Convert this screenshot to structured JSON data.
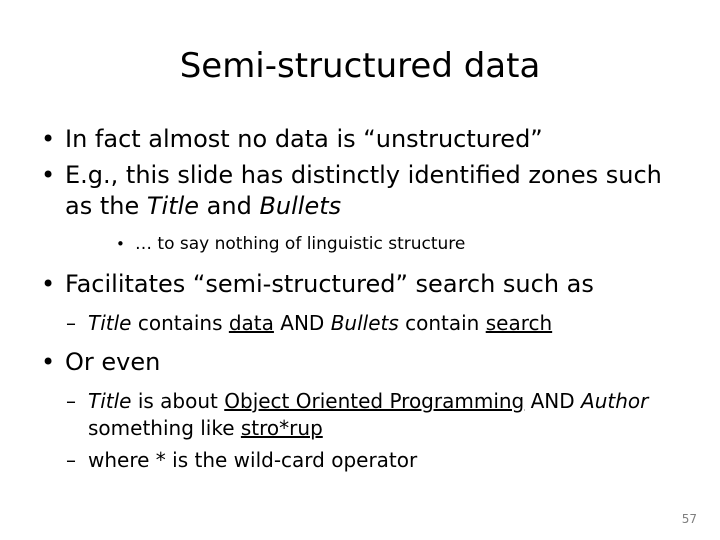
{
  "slide": {
    "title": "Semi-structured data",
    "page_number": "57",
    "bullet_glyph": "•",
    "dash_glyph": "–",
    "content": {
      "b1": "In fact almost no data is “unstructured”",
      "b2_a": "E.g., this slide has distinctly identified zones such as the ",
      "b2_title": "Title",
      "b2_b": " and ",
      "b2_bullets": "Bullets",
      "b3_sub": "… to say nothing of linguistic structure",
      "b4": "Facilitates “semi-structured” search such as",
      "b5_title": "Title",
      "b5_a": " contains ",
      "b5_data": "data",
      "b5_b": " AND ",
      "b5_bullets": "Bullets",
      "b5_c": " contain ",
      "b5_search": "search",
      "b6": "Or even",
      "b7_title": "Title",
      "b7_a": " is about ",
      "b7_oop": "Object Oriented Programming",
      "b7_b": " AND ",
      "b7_author": "Author",
      "b7_c": "  something like ",
      "b7_strorup": "stro*rup",
      "b8": "where * is the wild-card operator"
    }
  }
}
